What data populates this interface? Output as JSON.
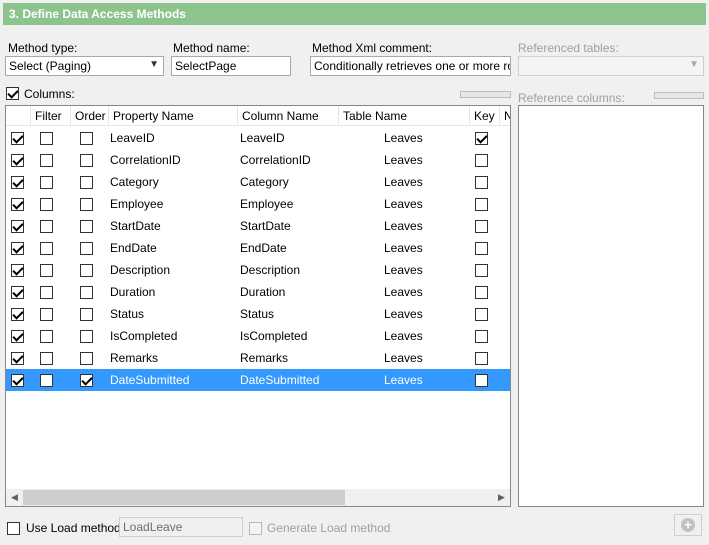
{
  "header": {
    "title": "3. Define Data Access Methods"
  },
  "form": {
    "method_type_label": "Method type:",
    "method_type_value": "Select (Paging)",
    "method_name_label": "Method name:",
    "method_name_value": "SelectPage",
    "xml_comment_label": "Method Xml comment:",
    "xml_comment_value": "Conditionally retrieves one or more rows fr",
    "referenced_tables_label": "Referenced tables:",
    "referenced_tables_value": "",
    "columns_label": "Columns:",
    "columns_checked": true,
    "reference_columns_label": "Reference columns:"
  },
  "grid": {
    "headers": [
      "Filter",
      "Order",
      "Property Name",
      "Column Name",
      "Table Name",
      "Key",
      "N"
    ],
    "rows": [
      {
        "check": true,
        "filter": false,
        "order": false,
        "property": "LeaveID",
        "column": "LeaveID",
        "table": "Leaves",
        "key": true
      },
      {
        "check": true,
        "filter": false,
        "order": false,
        "property": "CorrelationID",
        "column": "CorrelationID",
        "table": "Leaves",
        "key": false
      },
      {
        "check": true,
        "filter": false,
        "order": false,
        "property": "Category",
        "column": "Category",
        "table": "Leaves",
        "key": false
      },
      {
        "check": true,
        "filter": false,
        "order": false,
        "property": "Employee",
        "column": "Employee",
        "table": "Leaves",
        "key": false
      },
      {
        "check": true,
        "filter": false,
        "order": false,
        "property": "StartDate",
        "column": "StartDate",
        "table": "Leaves",
        "key": false
      },
      {
        "check": true,
        "filter": false,
        "order": false,
        "property": "EndDate",
        "column": "EndDate",
        "table": "Leaves",
        "key": false
      },
      {
        "check": true,
        "filter": false,
        "order": false,
        "property": "Description",
        "column": "Description",
        "table": "Leaves",
        "key": false
      },
      {
        "check": true,
        "filter": false,
        "order": false,
        "property": "Duration",
        "column": "Duration",
        "table": "Leaves",
        "key": false
      },
      {
        "check": true,
        "filter": false,
        "order": false,
        "property": "Status",
        "column": "Status",
        "table": "Leaves",
        "key": false
      },
      {
        "check": true,
        "filter": false,
        "order": false,
        "property": "IsCompleted",
        "column": "IsCompleted",
        "table": "Leaves",
        "key": false
      },
      {
        "check": true,
        "filter": false,
        "order": false,
        "property": "Remarks",
        "column": "Remarks",
        "table": "Leaves",
        "key": false
      },
      {
        "check": true,
        "filter": false,
        "order": true,
        "property": "DateSubmitted",
        "column": "DateSubmitted",
        "table": "Leaves",
        "key": false,
        "selected": true
      }
    ]
  },
  "footer": {
    "use_load_label": "Use Load method:",
    "use_load_checked": false,
    "load_method_value": "LoadLeave",
    "generate_load_label": "Generate Load method"
  },
  "colors": {
    "header_bg": "#8dc48d",
    "selection": "#3399ff"
  },
  "icons": {
    "dropdown": "chevron-down-icon",
    "add": "add-icon",
    "scroll_left": "arrow-left-icon",
    "scroll_right": "arrow-right-icon"
  }
}
